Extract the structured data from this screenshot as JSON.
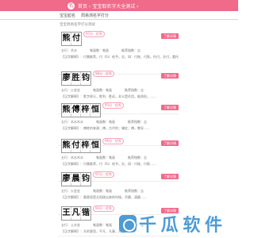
{
  "header": {
    "title": "首页 › 宝宝取名字大全测试 ›",
    "logo_letter": "名"
  },
  "subnav": {
    "items": [
      "宝宝起名",
      "周易测名字打分"
    ]
  },
  "breadcrumb": "宝宝周易名字打分测试",
  "detail_label": "了解详情",
  "cards": [
    {
      "chars": [
        "熊",
        "付"
      ],
      "score": "97分 · 优秀",
      "pinyin": "五行：木水",
      "five": "笔画数：笔画",
      "luck": "推荐指数：吉",
      "desc": "【汉字解释】：付属推荐，付（fù）给予。交，如：付账、付款。托付，交付，委托给……"
    },
    {
      "chars": [
        "廖",
        "胜",
        "钧"
      ],
      "score": "98分 · 优秀",
      "pinyin": "五行：火金金",
      "five": "笔画数：笔画",
      "luck": "推荐指数：吉",
      "desc": "【汉字解释】：胜字原义，胜利、胜诉。本义是任用，能承担，……"
    },
    {
      "chars": [
        "熊",
        "傅",
        "梓",
        "恒"
      ],
      "score": "95分 · 优秀",
      "pinyin": "五行：木水木水",
      "five": "笔画数：笔画",
      "luck": "推荐指数：吉",
      "desc": "【汉字解释】：傅姓的来源；傅，古代的；辅佐；傅，教导……"
    },
    {
      "chars": [
        "熊",
        "付",
        "梓",
        "恒"
      ],
      "score": "96分 · 优秀",
      "pinyin": "五行：木水木水",
      "five": "笔画数：笔画",
      "luck": "推荐指数：吉",
      "desc": "【汉字解释】：付属推荐，付（fù）给予。交，如：付账、付款……"
    },
    {
      "chars": [
        "廖",
        "晨",
        "钧"
      ],
      "score": "97分 · 优秀",
      "pinyin": "五行：火金金",
      "five": "笔画数：笔画",
      "luck": "推荐指数：吉",
      "desc": "【汉字解释】：晨意思是太阳刚出来的时候，早晨、清晨……"
    },
    {
      "chars": [
        "王",
        "凡",
        "锴"
      ],
      "score": "94分 · 优秀",
      "pinyin": "五行：土水金",
      "five": "笔画数：笔画",
      "luck": "推荐指数：吉",
      "desc": "【汉字解释】：凡的意思，平凡、凡事，凡是……"
    }
  ],
  "watermark": "千 瓜 软 件"
}
